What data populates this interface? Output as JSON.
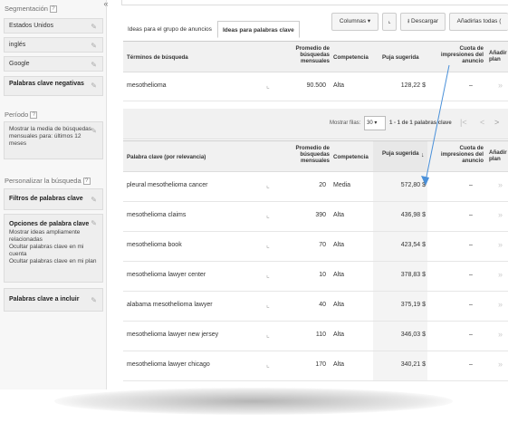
{
  "sidebar": {
    "segmentacion_title": "Segmentación",
    "help": "?",
    "items": [
      {
        "label": "Estados Unidos"
      },
      {
        "label": "inglés"
      },
      {
        "label": "Google"
      }
    ],
    "negative_label": "Palabras clave negativas",
    "periodo_title": "Período",
    "periodo_text": "Mostrar la media de búsquedas mensuales para: últimos 12 meses",
    "personalizar_title": "Personalizar la búsqueda",
    "filtros_label": "Filtros de palabras clave",
    "opciones_label": "Opciones de palabra clave",
    "opciones_lines": [
      "Mostrar ideas ampliamente relacionadas",
      "Ocultar palabras clave en mi cuenta",
      "Ocultar palabras clave en mi plan"
    ],
    "incluir_label": "Palabras clave a incluir",
    "collapse": "«"
  },
  "tabs": [
    {
      "label": "Ideas para el grupo de anuncios"
    },
    {
      "label": "Ideas para palabras clave"
    }
  ],
  "toolbar": {
    "columnas": "Columnas ▾",
    "chart_icon": "chart-icon",
    "descargar": "Descargar",
    "anadir_todas": "Añadirlas todas ("
  },
  "table1": {
    "headers": [
      "Términos de búsqueda",
      "Promedio de búsquedas mensuales",
      "Competencia",
      "Puja sugerida",
      "Cuota de impresiones del anuncio",
      "Añadir plan"
    ],
    "rows": [
      {
        "keyword": "mesothelioma",
        "searches": "90.500",
        "competition": "Alta",
        "bid": "128,22 $",
        "share": "–"
      }
    ]
  },
  "pager": {
    "show_rows": "Mostrar filas:",
    "rows_value": "30 ▾",
    "range": "1 - 1 de 1 palabras clave"
  },
  "table2": {
    "headers": [
      "Palabra clave (por relevancia)",
      "Promedio de búsquedas mensuales",
      "Competencia",
      "Puja sugerida",
      "Cuota de impresiones del anuncio",
      "Añadir plan"
    ],
    "rows": [
      {
        "keyword": "pleural mesothelioma cancer",
        "searches": "20",
        "competition": "Media",
        "bid": "572,80 $",
        "share": "–"
      },
      {
        "keyword": "mesothelioma claims",
        "searches": "390",
        "competition": "Alta",
        "bid": "436,98 $",
        "share": "–"
      },
      {
        "keyword": "mesothelioma book",
        "searches": "70",
        "competition": "Alta",
        "bid": "423,54 $",
        "share": "–"
      },
      {
        "keyword": "mesothelioma lawyer center",
        "searches": "10",
        "competition": "Alta",
        "bid": "378,83 $",
        "share": "–"
      },
      {
        "keyword": "alabama mesothelioma lawyer",
        "searches": "40",
        "competition": "Alta",
        "bid": "375,19 $",
        "share": "–"
      },
      {
        "keyword": "mesothelioma lawyer new jersey",
        "searches": "110",
        "competition": "Alta",
        "bid": "346,03 $",
        "share": "–"
      },
      {
        "keyword": "mesothelioma lawyer chicago",
        "searches": "170",
        "competition": "Alta",
        "bid": "340,21 $",
        "share": "–"
      }
    ]
  },
  "colors": {
    "arrow": "#4a90d9",
    "header_bg": "#f1f1f1",
    "sorted_bg": "#e8e8e8"
  }
}
